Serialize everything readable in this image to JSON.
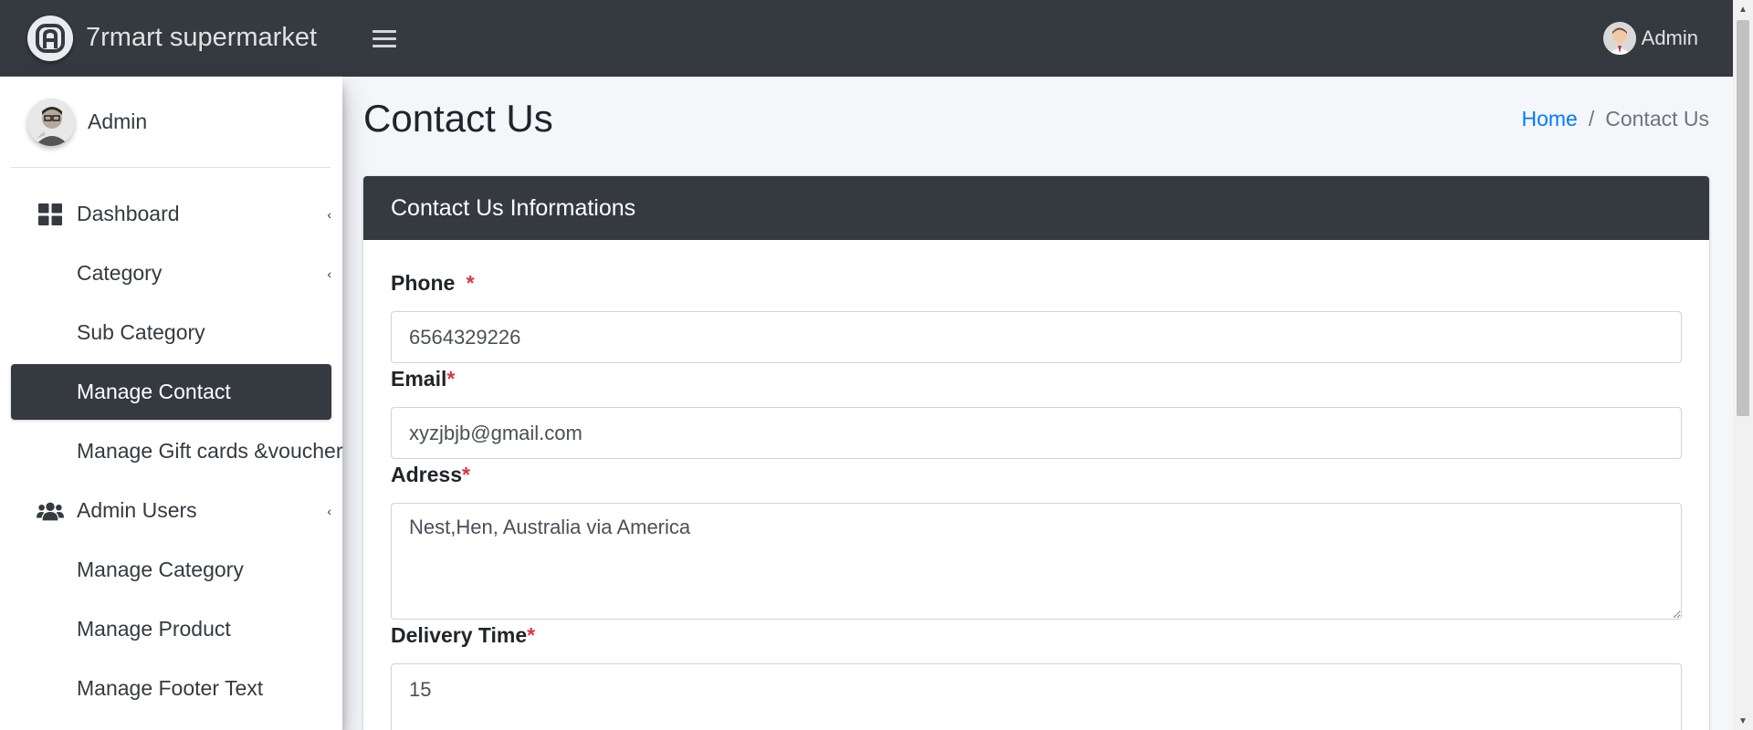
{
  "app": {
    "brand_name": "7rmart supermarket",
    "user_name": "Admin"
  },
  "sidebar": {
    "user_name": "Admin",
    "items": [
      {
        "label": "Dashboard",
        "icon": "th-large-icon",
        "has_caret": true,
        "active": false
      },
      {
        "label": "Category",
        "icon": "",
        "has_caret": true,
        "active": false
      },
      {
        "label": "Sub Category",
        "icon": "",
        "has_caret": false,
        "active": false
      },
      {
        "label": "Manage Contact",
        "icon": "",
        "has_caret": false,
        "active": true
      },
      {
        "label": "Manage Gift cards &voucher",
        "icon": "",
        "has_caret": false,
        "active": false
      },
      {
        "label": "Admin Users",
        "icon": "users-icon",
        "has_caret": true,
        "active": false
      },
      {
        "label": "Manage Category",
        "icon": "",
        "has_caret": false,
        "active": false
      },
      {
        "label": "Manage Product",
        "icon": "",
        "has_caret": false,
        "active": false
      },
      {
        "label": "Manage Footer Text",
        "icon": "",
        "has_caret": false,
        "active": false
      }
    ]
  },
  "page": {
    "title": "Contact Us",
    "breadcrumb": {
      "home": "Home",
      "separator": "/",
      "current": "Contact Us"
    }
  },
  "card": {
    "title": "Contact Us Informations",
    "fields": {
      "phone": {
        "label": "Phone",
        "required_mark": "*",
        "value": "6564329226"
      },
      "email": {
        "label": "Email",
        "required_mark": "*",
        "value": "xyzjbjb@gmail.com"
      },
      "address": {
        "label": "Adress",
        "required_mark": "*",
        "value": "Nest,Hen, Australia via America"
      },
      "delivery_time": {
        "label": "Delivery Time",
        "required_mark": "*",
        "value": "15"
      }
    }
  },
  "colors": {
    "navbar": "#343a40",
    "active_item": "#343a40",
    "link": "#007bff",
    "required": "#dc3545"
  }
}
